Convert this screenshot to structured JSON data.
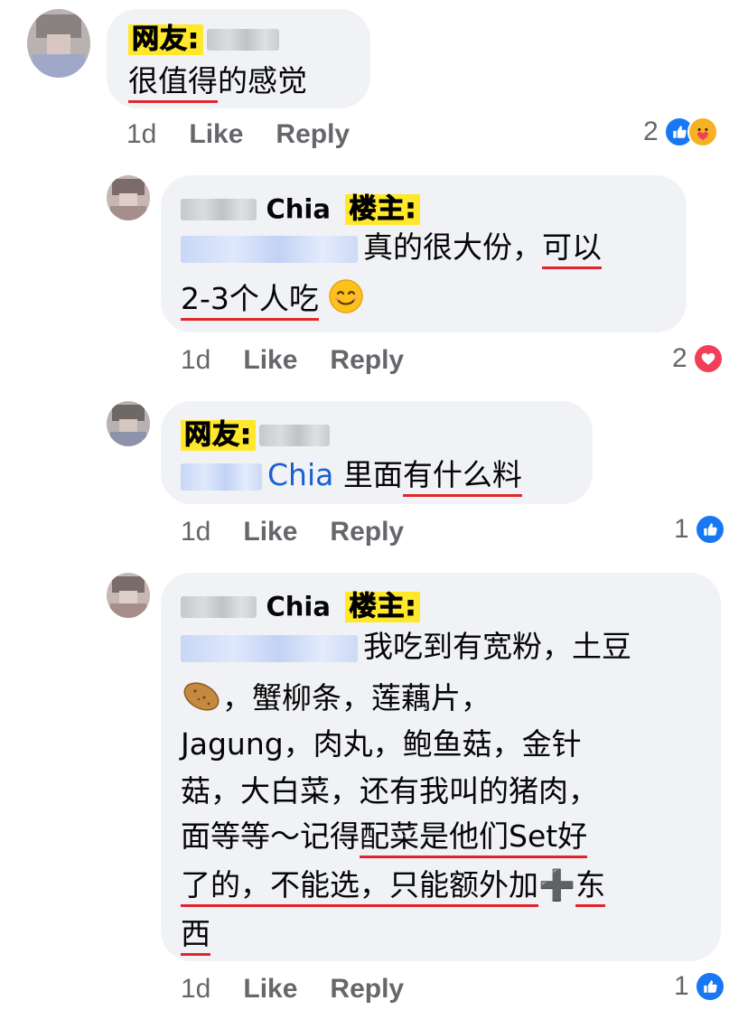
{
  "comments": [
    {
      "tag": "网友:",
      "text_underlined": "很值得",
      "text_rest": "的感觉",
      "meta": {
        "time": "1d",
        "like": "Like",
        "reply": "Reply"
      },
      "reaction_count": "2",
      "reactions": [
        "like-icon",
        "care-icon"
      ]
    },
    {
      "name": "Chia",
      "tag": "楼主:",
      "line1_text": "真的很大份，",
      "line1_ul": "可以",
      "line2_ul": "2-3个人吃",
      "meta": {
        "time": "1d",
        "like": "Like",
        "reply": "Reply"
      },
      "reaction_count": "2",
      "reactions": [
        "love-icon"
      ]
    },
    {
      "tag": "网友:",
      "mention": "Chia",
      "text_rest": "里面",
      "text_ul": "有什么料",
      "meta": {
        "time": "1d",
        "like": "Like",
        "reply": "Reply"
      },
      "reaction_count": "1",
      "reactions": [
        "like-icon"
      ]
    },
    {
      "name": "Chia",
      "tag": "楼主:",
      "line1": "我吃到有宽粉，土豆",
      "line2": "，蟹柳条，莲藕片，",
      "line3": "Jagung，肉丸，鲍鱼菇，金针",
      "line4": "菇，大白菜，还有我叫的猪肉，",
      "line5_plain": "面等等～记得",
      "line5_ul": "配菜是他们Set好",
      "line6_ul": "了的，不能选，只能额外加",
      "line6_plus": "➕",
      "line6_end": "东",
      "line7_ul": "西",
      "meta": {
        "time": "1d",
        "like": "Like",
        "reply": "Reply"
      },
      "reaction_count": "1",
      "reactions": [
        "like-icon"
      ]
    }
  ],
  "colors": {
    "bubble": "#f0f2f5",
    "underline": "#e0262b",
    "tag_bg": "#ffe82c",
    "like": "#1877f2",
    "love": "#f33e58"
  }
}
